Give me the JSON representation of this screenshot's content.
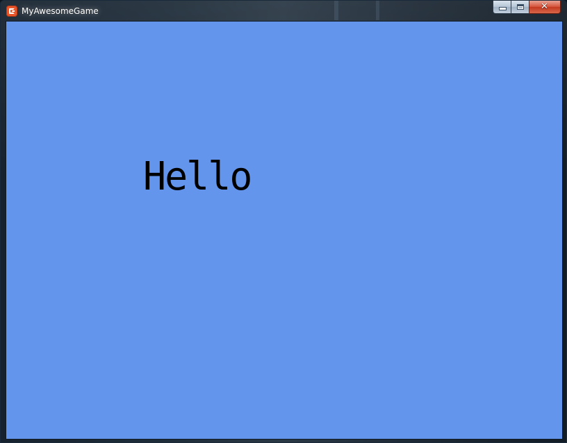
{
  "window": {
    "title": "MyAwesomeGame",
    "app_icon": "monogame-logo-icon",
    "buttons": {
      "minimize_icon": "minimize-icon",
      "maximize_icon": "maximize-icon",
      "close_icon": "close-icon",
      "close_glyph": "✕"
    }
  },
  "game": {
    "background_color": "#6495ED",
    "text": "Hello",
    "text_color": "#000000"
  }
}
